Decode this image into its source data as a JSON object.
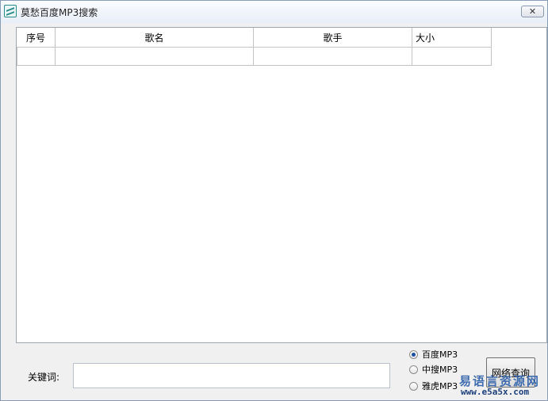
{
  "window": {
    "title": "莫愁百度MP3搜索",
    "close_symbol": "✕"
  },
  "list": {
    "columns": [
      "序号",
      "歌名",
      "歌手",
      "大小"
    ],
    "rows": [
      [
        "",
        "",
        "",
        ""
      ]
    ]
  },
  "search": {
    "keyword_label": "关键词:",
    "keyword_value": "",
    "sources": [
      {
        "label": "百度MP3",
        "selected": true
      },
      {
        "label": "中搜MP3",
        "selected": false
      },
      {
        "label": "雅虎MP3",
        "selected": false
      }
    ],
    "button_label": "网络查询"
  },
  "watermark": {
    "line1": "易语言资源网",
    "line2": "www.e5a5x.com"
  }
}
